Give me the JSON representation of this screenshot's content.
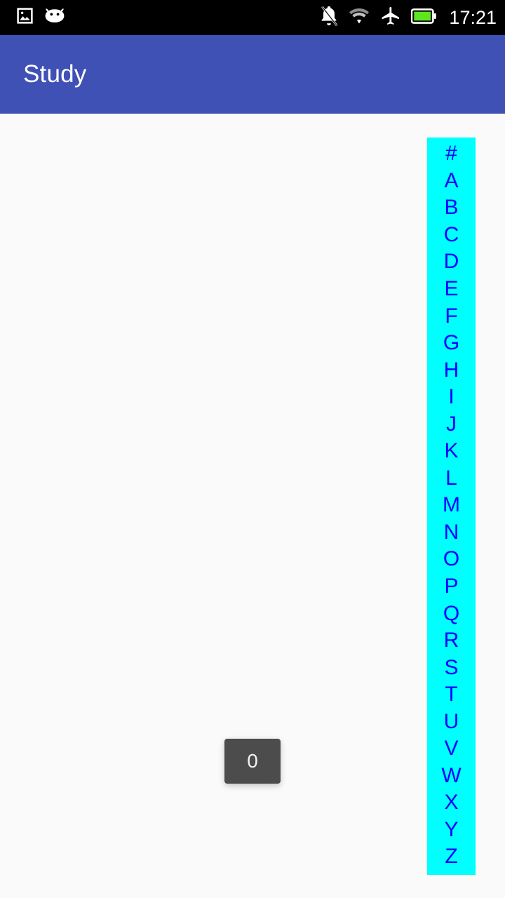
{
  "status_bar": {
    "background_color": "#000000",
    "clock": "17:21",
    "left_icons": [
      {
        "name": "image-icon",
        "label": "image"
      },
      {
        "name": "android-face-icon",
        "label": "android"
      }
    ],
    "right_icons": [
      {
        "name": "notifications-off-icon",
        "label": "silent"
      },
      {
        "name": "wifi-icon",
        "label": "wifi"
      },
      {
        "name": "airplane-mode-icon",
        "label": "airplane mode"
      },
      {
        "name": "battery-full-icon",
        "label": "battery full",
        "color": "#5de620"
      }
    ]
  },
  "app_bar": {
    "title": "Study",
    "background_color": "#3f51b5",
    "title_color": "#ffffff"
  },
  "content": {
    "background_color": "#fafafa"
  },
  "alpha_index": {
    "background_color": "#00ffff",
    "letter_color": "#0000ff",
    "letters": [
      "#",
      "A",
      "B",
      "C",
      "D",
      "E",
      "F",
      "G",
      "H",
      "I",
      "J",
      "K",
      "L",
      "M",
      "N",
      "O",
      "P",
      "Q",
      "R",
      "S",
      "T",
      "U",
      "V",
      "W",
      "X",
      "Y",
      "Z"
    ]
  },
  "toast": {
    "text": "0",
    "background_color": "#4c4c4c",
    "text_color": "#f2f2f2"
  }
}
